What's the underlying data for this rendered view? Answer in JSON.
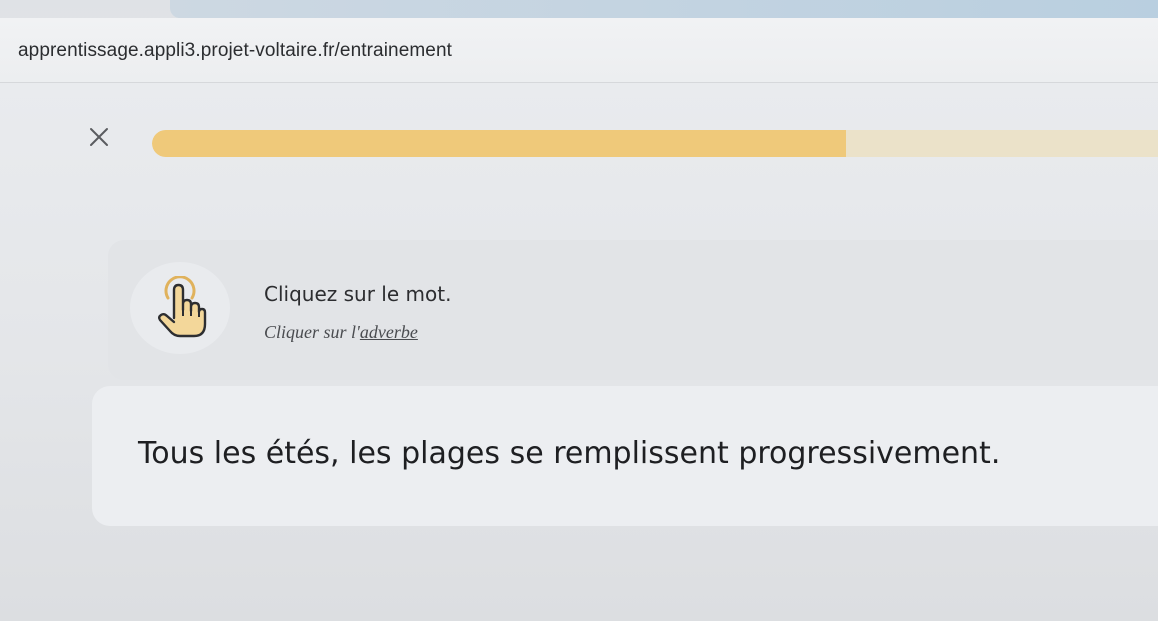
{
  "browser": {
    "url": "apprentissage.appli3.projet-voltaire.fr/entrainement"
  },
  "exercise": {
    "progress": 0.69,
    "close_icon": "close-icon",
    "instruction_icon": "pointing-hand-icon",
    "instruction_title": "Cliquez sur le mot.",
    "instruction_prefix": "Cliquer sur l'",
    "instruction_target": "adverbe",
    "sentence_words": [
      "Tous",
      "les",
      "étés,",
      "les",
      "plages",
      "se",
      "remplissent",
      "progressivement."
    ]
  },
  "colors": {
    "progress_fill": "#efc97a",
    "progress_track": "#ebe2c9",
    "card_background": "#e2e4e7"
  }
}
